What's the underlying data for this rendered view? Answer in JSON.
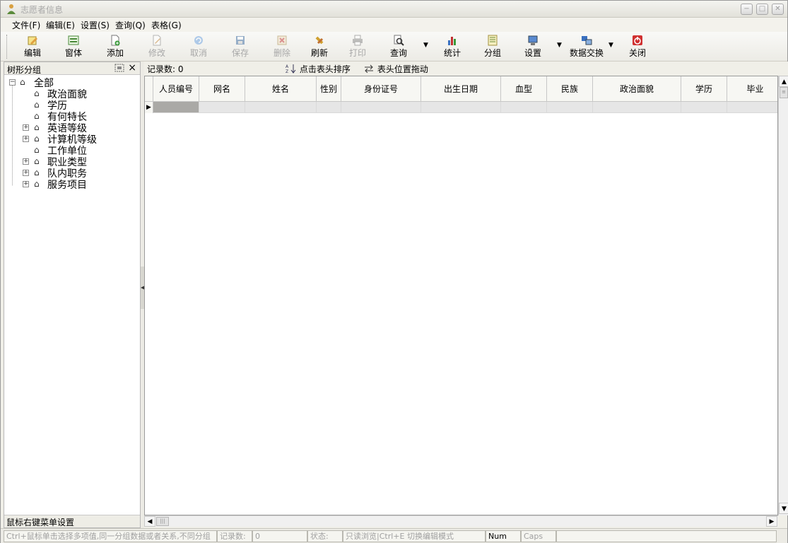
{
  "window": {
    "title": "志愿者信息",
    "icon": "volunteer-person-icon",
    "minimize_icon": "−",
    "maximize_icon": "□",
    "close_icon": "✕"
  },
  "menu": [
    "文件(F)",
    "编辑(E)",
    "设置(S)",
    "查询(Q)",
    "表格(G)"
  ],
  "toolbar": {
    "buttons": [
      {
        "label": "编辑",
        "icon": "edit-pencil-icon",
        "enabled": true
      },
      {
        "label": "窗体",
        "icon": "form-window-icon",
        "enabled": true
      },
      {
        "label": "添加",
        "icon": "add-document-icon",
        "enabled": true
      },
      {
        "label": "修改",
        "icon": "modify-icon",
        "enabled": false
      },
      {
        "label": "取消",
        "icon": "undo-icon",
        "enabled": false
      },
      {
        "label": "保存",
        "icon": "save-icon",
        "enabled": false
      },
      {
        "label": "删除",
        "icon": "delete-icon",
        "enabled": false
      },
      {
        "label": "刷新",
        "icon": "refresh-icon",
        "enabled": true
      },
      {
        "label": "打印",
        "icon": "print-icon",
        "enabled": false
      },
      {
        "label": "查询",
        "icon": "search-icon",
        "enabled": true
      },
      {
        "label": "统计",
        "icon": "bar-chart-icon",
        "enabled": true
      },
      {
        "label": "分组",
        "icon": "group-icon",
        "enabled": true
      },
      {
        "label": "设置",
        "icon": "settings-icon",
        "enabled": true
      },
      {
        "label": "数据交换",
        "icon": "data-exchange-icon",
        "enabled": true
      },
      {
        "label": "关闭",
        "icon": "power-icon",
        "enabled": true
      }
    ]
  },
  "left_panel": {
    "title": "树形分组",
    "footer": "鼠标右键菜单设置",
    "tree": [
      {
        "label": "全部",
        "level": 0,
        "expander": "−"
      },
      {
        "label": "政治面貌",
        "level": 1,
        "expander": ""
      },
      {
        "label": "学历",
        "level": 1,
        "expander": ""
      },
      {
        "label": "有何特长",
        "level": 1,
        "expander": ""
      },
      {
        "label": "英语等级",
        "level": 1,
        "expander": "+"
      },
      {
        "label": "计算机等级",
        "level": 1,
        "expander": "+"
      },
      {
        "label": "工作单位",
        "level": 1,
        "expander": ""
      },
      {
        "label": "职业类型",
        "level": 1,
        "expander": "+"
      },
      {
        "label": "队内职务",
        "level": 1,
        "expander": "+"
      },
      {
        "label": "服务项目",
        "level": 1,
        "expander": "+"
      }
    ]
  },
  "infobar": {
    "record_count": "记录数: 0",
    "sort_hint": "点击表头排序",
    "drag_hint": "表头位置拖动"
  },
  "grid": {
    "columns": [
      "人员编号",
      "网名",
      "姓名",
      "性别",
      "身份证号",
      "出生日期",
      "血型",
      "民族",
      "政治面貌",
      "学历",
      "毕业"
    ]
  },
  "statusbar": {
    "hint": "Ctrl+鼠标单击选择多项值,同一分组数据或者关系,不同分组",
    "record_label": "记录数:",
    "record_value": "0",
    "state_label": "状态:",
    "state_value": "只读浏览|Ctrl+E 切换编辑模式",
    "num": "Num",
    "caps": "Caps"
  }
}
